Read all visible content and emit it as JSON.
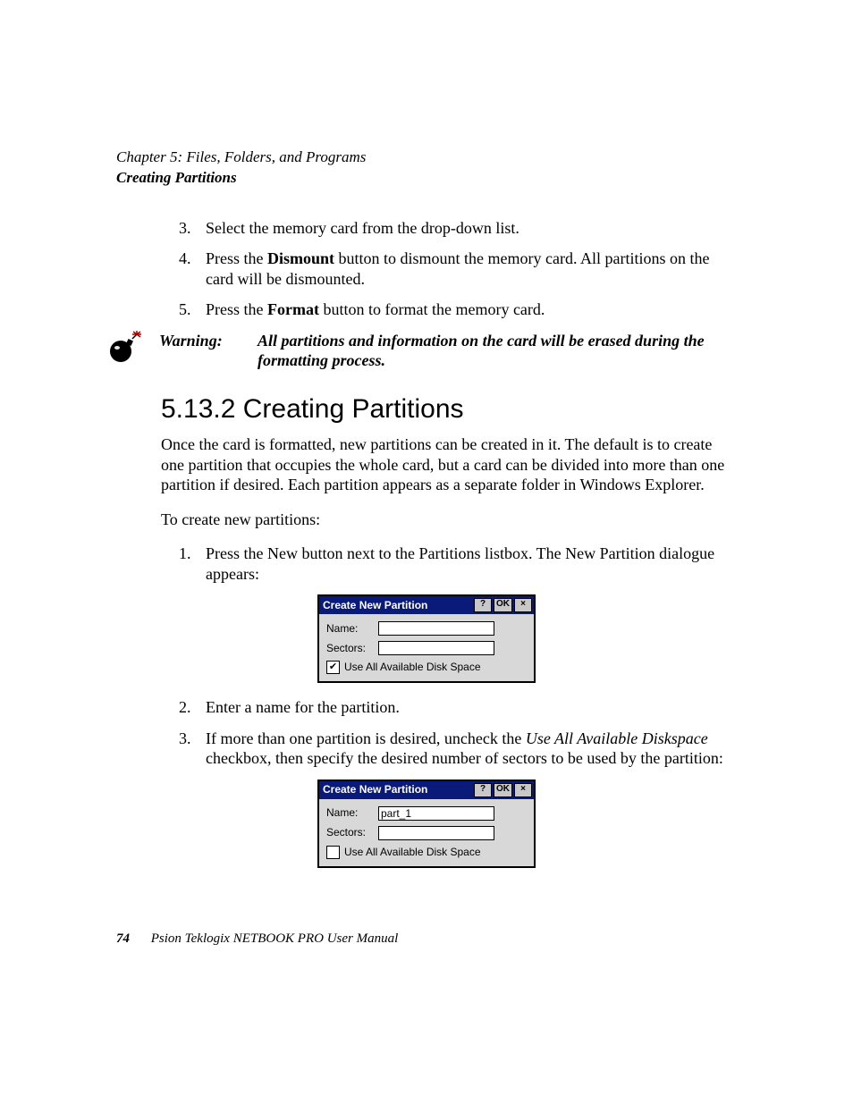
{
  "header": {
    "chapter": "Chapter 5:  Files, Folders, and Programs",
    "section": "Creating Partitions"
  },
  "listA": {
    "i3": {
      "num": "3.",
      "text": "Select the memory card from the drop-down list."
    },
    "i4": {
      "num": "4.",
      "pre": "Press the ",
      "b": "Dismount",
      "post": " button to dismount the memory card. All partitions on the card will be dismounted."
    },
    "i5": {
      "num": "5.",
      "pre": "Press the ",
      "b": "Format",
      "post": " button to format the memory card."
    }
  },
  "warning": {
    "label": "Warning:",
    "text": "All partitions and information on the card will be erased during the formatting process."
  },
  "heading": "5.13.2  Creating Partitions",
  "para1": "Once the card is formatted, new partitions can be created in it. The default is to create one partition that occupies the whole card, but a card can be divided into more than one partition if desired. Each partition appears as a separate folder in Windows Explorer.",
  "para2": "To create new partitions:",
  "listB": {
    "i1": {
      "num": "1.",
      "text": "Press the New button next to the Partitions listbox. The New Partition dialogue appears:"
    },
    "i2": {
      "num": "2.",
      "text": "Enter a name for the partition."
    },
    "i3": {
      "num": "3.",
      "pre": "If more than one partition is desired, uncheck the ",
      "em": "Use All Available Diskspace",
      "post": " checkbox, then specify the desired number of sectors to be used by the partition:"
    }
  },
  "dialog": {
    "title": "Create New Partition",
    "help": "?",
    "ok": "OK",
    "close": "×",
    "nameLabel": "Name:",
    "sectorsLabel": "Sectors:",
    "chkLabel": "Use All Available Disk Space",
    "d1": {
      "name": "",
      "sectors": "",
      "checked": "✔"
    },
    "d2": {
      "name": "part_1",
      "sectors": "",
      "checked": ""
    }
  },
  "footer": {
    "page": "74",
    "text": "Psion Teklogix NETBOOK PRO User Manual"
  }
}
